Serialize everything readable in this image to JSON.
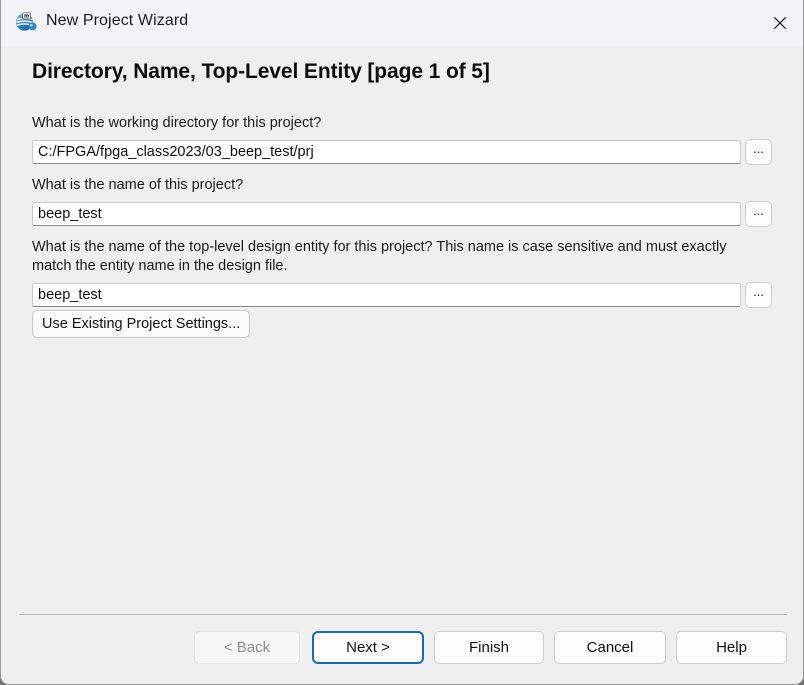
{
  "window": {
    "title": "New Project Wizard",
    "app_icon": "quartus-globe-icon",
    "close_icon": "close-icon",
    "accent_color": "#0f6cbd",
    "background_color": "#efefef",
    "titlebar_color": "#f4f4f8"
  },
  "page": {
    "heading": "Directory, Name, Top-Level Entity [page 1 of 5]"
  },
  "fields": [
    {
      "label": "What is the working directory for this project?",
      "value": "C:/FPGA/fpga_class2023/03_beep_test/prj",
      "placeholder": "",
      "browse_label": "..."
    },
    {
      "label": "What is the name of this project?",
      "value": "beep_test",
      "placeholder": "",
      "browse_label": "..."
    },
    {
      "label": "What is the name of the top-level design entity for this project? This name is case sensitive and must exactly match the entity name in the design file.",
      "value": "beep_test",
      "placeholder": "",
      "browse_label": "..."
    }
  ],
  "actions": {
    "use_existing_settings": "Use Existing Project Settings..."
  },
  "footer": {
    "back": "< Back",
    "next": "Next >",
    "finish": "Finish",
    "cancel": "Cancel",
    "help": "Help"
  }
}
